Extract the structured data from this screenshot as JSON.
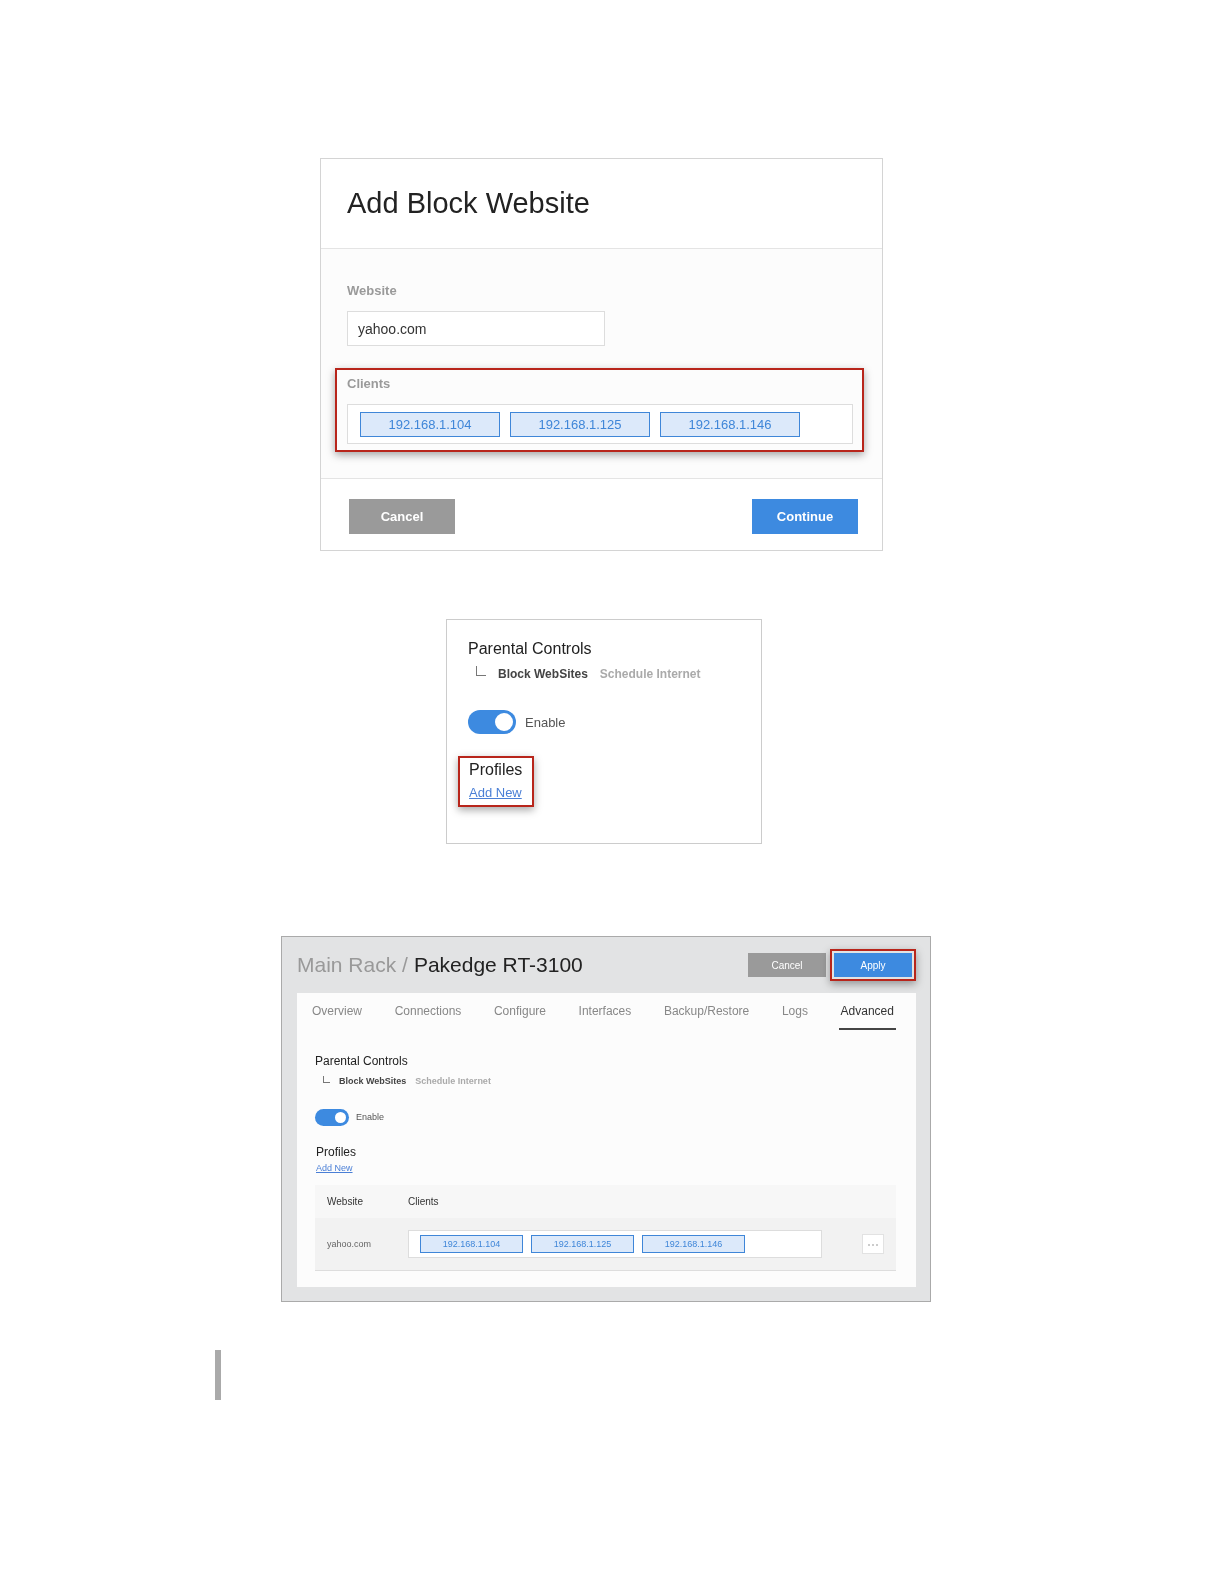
{
  "add_block_dialog": {
    "title": "Add Block Website",
    "website_label": "Website",
    "website_value": "yahoo.com",
    "clients": {
      "label": "Clients",
      "highlighted": true,
      "items": [
        "192.168.1.104",
        "192.168.1.125",
        "192.168.1.146"
      ]
    },
    "buttons": [
      {
        "label": "Cancel",
        "kind": "secondary",
        "highlighted": false
      },
      {
        "label": "Continue",
        "kind": "primary",
        "highlighted": false
      }
    ]
  },
  "parental_panel": {
    "title": "Parental Controls",
    "subtabs": [
      {
        "label": "Block WebSites",
        "selected": true
      },
      {
        "label": "Schedule Internet",
        "selected": false
      }
    ],
    "enable": {
      "label": "Enable",
      "on": true
    },
    "profiles": {
      "title": "Profiles",
      "link": "Add New",
      "highlighted": true
    }
  },
  "device_page": {
    "breadcrumb_parent": "Main Rack /",
    "device_name": "Pakedge RT-3100",
    "buttons": [
      {
        "label": "Cancel",
        "kind": "secondary",
        "highlighted": false
      },
      {
        "label": "Apply",
        "kind": "primary",
        "highlighted": true
      }
    ],
    "tabs": [
      {
        "label": "Overview",
        "selected": false
      },
      {
        "label": "Connections",
        "selected": false
      },
      {
        "label": "Configure",
        "selected": false
      },
      {
        "label": "Interfaces",
        "selected": false
      },
      {
        "label": "Backup/Restore",
        "selected": false
      },
      {
        "label": "Logs",
        "selected": false
      },
      {
        "label": "Advanced",
        "selected": true
      }
    ],
    "section_title": "Parental Controls",
    "subtabs": [
      {
        "label": "Block WebSites",
        "selected": true
      },
      {
        "label": "Schedule Internet",
        "selected": false
      }
    ],
    "enable": {
      "label": "Enable",
      "on": true
    },
    "profiles": {
      "title": "Profiles",
      "link": "Add New",
      "highlighted": false
    },
    "table": {
      "columns": [
        "Website",
        "Clients"
      ],
      "rows": [
        {
          "website": "yahoo.com",
          "clients": [
            "192.168.1.104",
            "192.168.1.125",
            "192.168.1.146"
          ]
        }
      ]
    }
  }
}
